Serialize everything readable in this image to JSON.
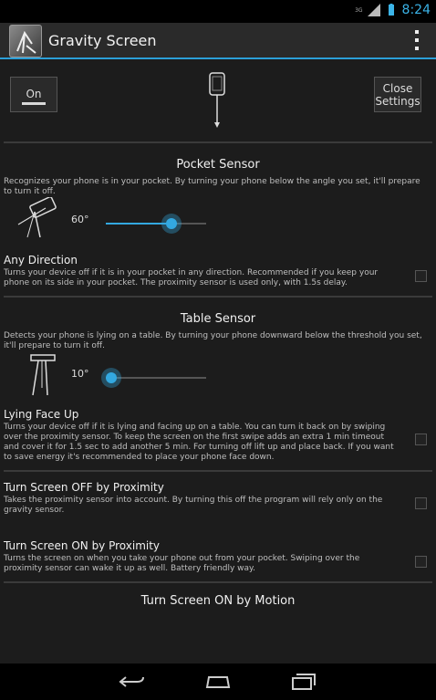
{
  "status": {
    "time": "8:24",
    "network": "3G"
  },
  "app": {
    "title": "Gravity Screen"
  },
  "topbar": {
    "on_label": "On",
    "close_label": "Close Settings"
  },
  "pocket": {
    "title": "Pocket Sensor",
    "description": "Recognizes your phone is in your pocket. By turning your phone below the angle you set, it'll prepare to turn it off.",
    "angle_label": "60°",
    "slider_fraction": 0.65
  },
  "any_direction": {
    "title": "Any Direction",
    "description": "Turns your device off if it is in your pocket in any direction. Recommended if you keep your phone on its side in your pocket. The proximity sensor is used only, with 1.5s delay.",
    "checked": false
  },
  "table": {
    "title": "Table Sensor",
    "description": "Detects your phone is lying on a table. By turning your phone downward below the threshold you set, it'll prepare to turn it off.",
    "angle_label": "10°",
    "slider_fraction": 0.05
  },
  "face_up": {
    "title": "Lying Face Up",
    "description": "Turns your device off if it is lying and facing up on a table. You can turn it back on by swiping over the proximity sensor. To keep the screen on the first swipe adds an extra 1 min timeout and cover it for 1.5 sec to add another 5 min. For turning off lift up and place back. If you want to save energy it's recommended to place your phone face down.",
    "checked": false
  },
  "off_proximity": {
    "title": "Turn Screen OFF by Proximity",
    "description": "Takes the proximity sensor into account. By turning this off the program will rely only on the gravity sensor.",
    "checked": false
  },
  "on_proximity": {
    "title": "Turn Screen ON by Proximity",
    "description": "Turns the screen on when you take your phone out from your pocket. Swiping over the proximity sensor can wake it up as well. Battery friendly way.",
    "checked": false
  },
  "motion": {
    "title": "Turn Screen ON by Motion"
  },
  "icons": {
    "back": "back-icon",
    "home": "home-icon",
    "recents": "recents-icon",
    "overflow": "overflow-menu-icon"
  },
  "colors": {
    "accent": "#33a8e0",
    "background": "#1c1c1c"
  }
}
